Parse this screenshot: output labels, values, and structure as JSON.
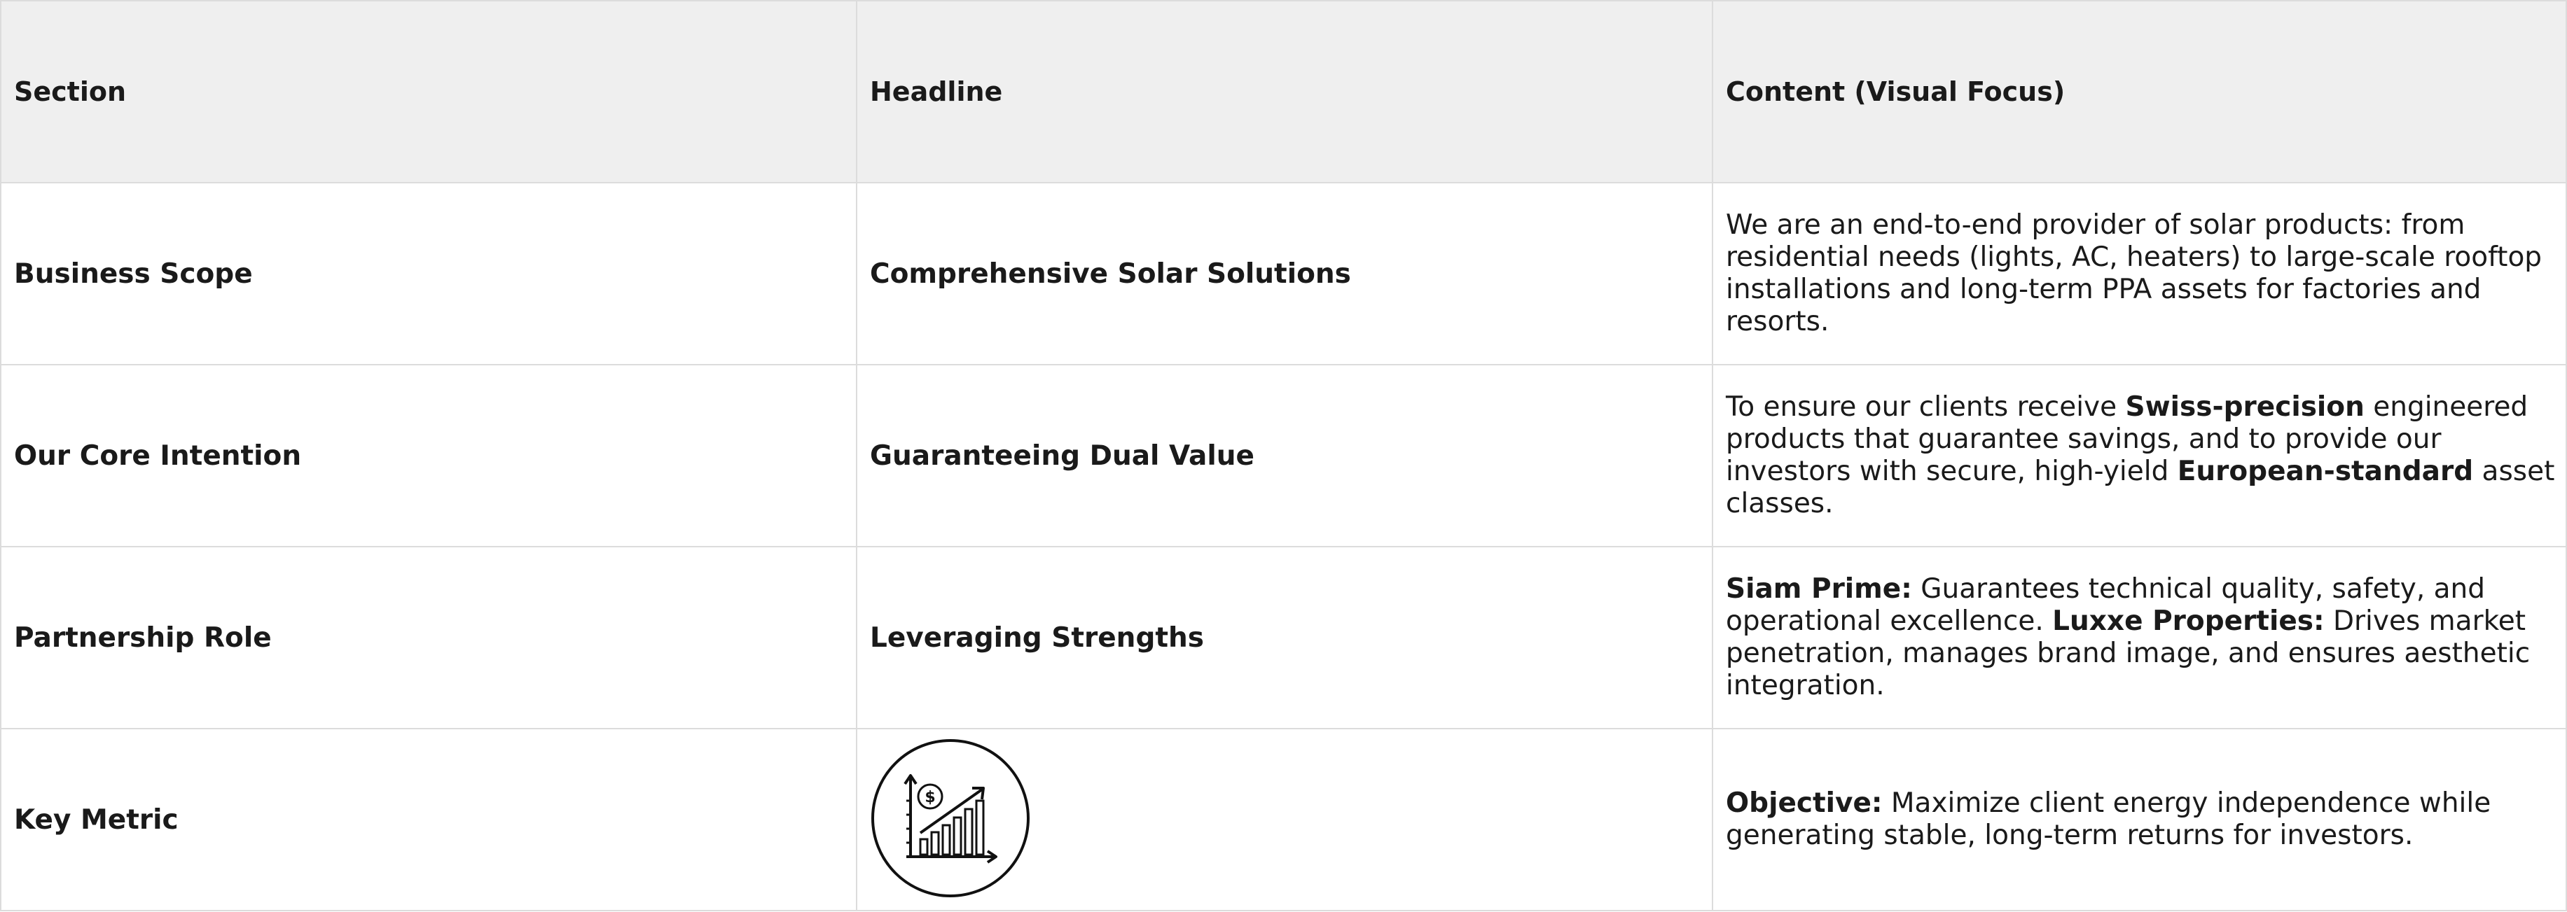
{
  "table": {
    "headers": [
      "Section",
      "Headline",
      "Content (Visual Focus)"
    ],
    "rows": [
      {
        "section": "Business Scope",
        "headline": "Comprehensive Solar Solutions",
        "content": [
          {
            "text": "We are an end-to-end provider of solar products: from residential needs (lights, AC, heaters) to large-scale rooftop installations and long-term PPA assets for factories and resorts.",
            "bold": false
          }
        ]
      },
      {
        "section": "Our Core Intention",
        "headline": "Guaranteeing Dual Value",
        "content": [
          {
            "text": "To ensure our clients receive ",
            "bold": false
          },
          {
            "text": "Swiss-precision",
            "bold": true
          },
          {
            "text": " engineered products that guarantee savings, and to provide our investors with secure, high-yield ",
            "bold": false
          },
          {
            "text": "European-standard",
            "bold": true
          },
          {
            "text": " asset classes.",
            "bold": false
          }
        ]
      },
      {
        "section": "Partnership Role",
        "headline": "Leveraging Strengths",
        "content": [
          {
            "text": "Siam Prime:",
            "bold": true
          },
          {
            "text": " Guarantees technical quality, safety, and operational excellence. ",
            "bold": false
          },
          {
            "text": "Luxxe Properties:",
            "bold": true
          },
          {
            "text": " Drives market penetration, manages brand image, and ensures aesthetic integration.",
            "bold": false
          }
        ]
      },
      {
        "section": "Key Metric",
        "headline_icon": "financial-growth-chart-icon",
        "content": [
          {
            "text": "Objective:",
            "bold": true
          },
          {
            "text": " Maximize client energy independence while generating stable, long-term returns for investors.",
            "bold": false
          }
        ]
      }
    ]
  }
}
